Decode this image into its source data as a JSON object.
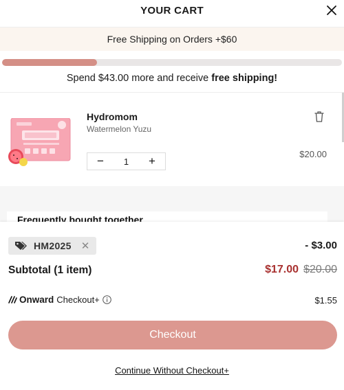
{
  "header": {
    "title": "YOUR CART",
    "close_icon": "close-icon"
  },
  "announcement": {
    "text": "Free Shipping on Orders +$60"
  },
  "shipping_progress": {
    "fraction": 0.28,
    "message_prefix": "Spend $43.00 more and receive ",
    "message_bold": "free shipping!"
  },
  "cart": {
    "items": [
      {
        "title": "Hydromom",
        "variant": "Watermelon Yuzu",
        "quantity": "1",
        "price": "$20.00",
        "image_icon": "hydromom-box-image",
        "remove_icon": "trash-icon"
      }
    ]
  },
  "recommendations": {
    "title": "Frequently bought together"
  },
  "discount": {
    "code": "HM2025",
    "amount": "- $3.00"
  },
  "subtotal": {
    "label": "Subtotal (1 item)",
    "sale_price": "$17.00",
    "original_price": "$20.00"
  },
  "onward": {
    "brand": "Onward",
    "label": "Checkout+",
    "price": "$1.55"
  },
  "actions": {
    "checkout_label": "Checkout",
    "continue_label": "Continue Without Checkout+"
  },
  "colors": {
    "accent": "#dc9890",
    "progress": "#d48f86",
    "sale": "#a8302f",
    "banner_bg": "#fbf5ef"
  }
}
